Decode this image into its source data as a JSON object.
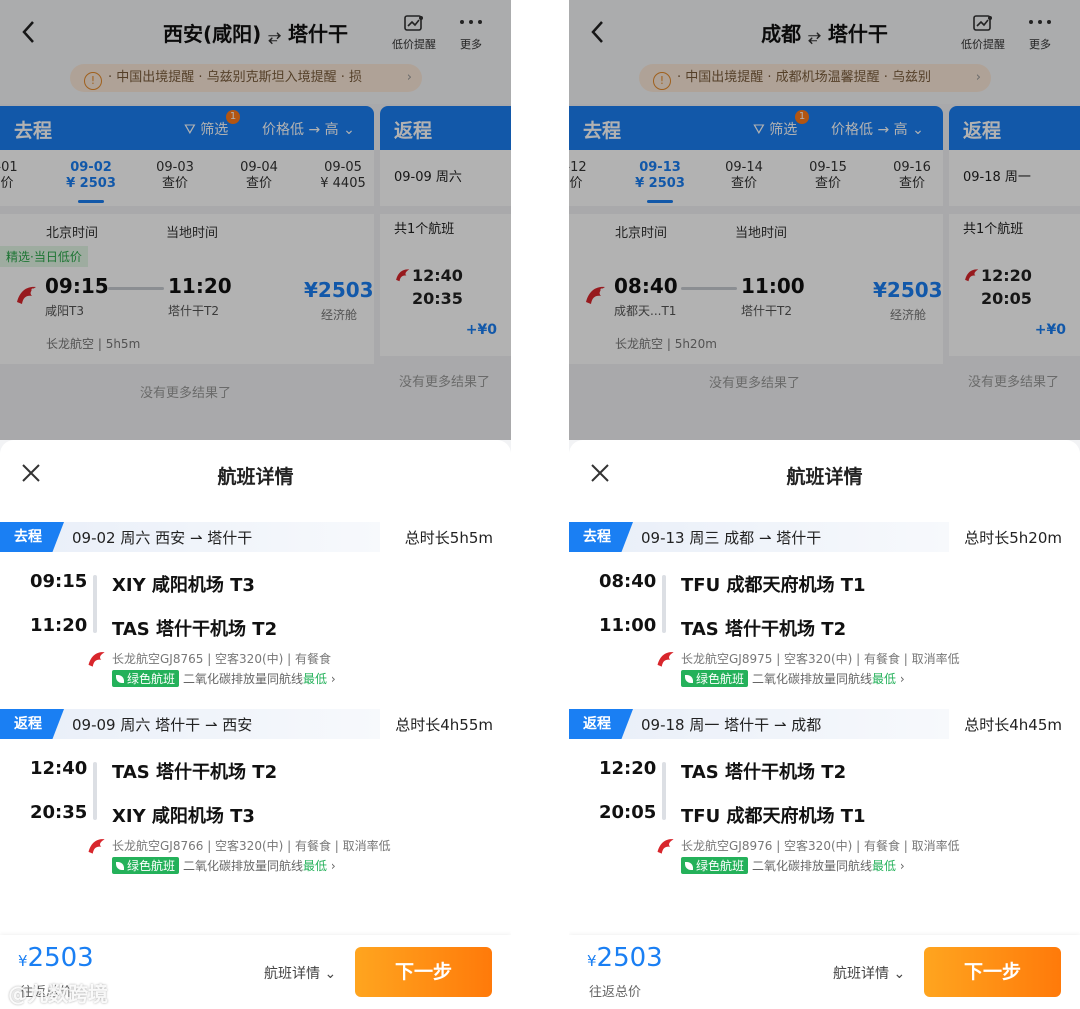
{
  "left": {
    "header": {
      "route_from": "西安(咸阳)",
      "route_to": "塔什干",
      "alert_label": "低价提醒",
      "more_label": "更多"
    },
    "notice": {
      "text": "· 中国出境提醒 · 乌兹别克斯坦入境提醒 · 损"
    },
    "outbound_tab": {
      "title": "去程",
      "filter_label": "筛选",
      "filter_badge": "1",
      "sort_label": "价格低 → 高"
    },
    "return_tab": {
      "title": "返程",
      "date": "09-09 周六",
      "count": "共1个航班",
      "dep_time": "12:40",
      "arr_time": "20:35",
      "extra_price": "+¥0",
      "no_more": "没有更多结果了"
    },
    "dates": [
      {
        "d": "-01",
        "p": "价"
      },
      {
        "d": "09-02",
        "p": "¥ 2503"
      },
      {
        "d": "09-03",
        "p": "查价"
      },
      {
        "d": "09-04",
        "p": "查价"
      },
      {
        "d": "09-05",
        "p": "¥ 4405"
      }
    ],
    "list_header": {
      "beijing": "北京时间",
      "local": "当地时间"
    },
    "flight": {
      "tag": "精选·当日低价",
      "dep": "09:15",
      "arr": "11:20",
      "dep_term": "咸阳T3",
      "arr_term": "塔什干T2",
      "price": "¥2503",
      "cabin": "经济舱",
      "airline": "长龙航空",
      "duration": "5h5m"
    },
    "no_more": "没有更多结果了",
    "sheet": {
      "title": "航班详情",
      "outbound": {
        "label": "去程",
        "info": "09-02 周六 西安 ⇀ 塔什干",
        "duration": "总时长5h5m",
        "dep_time": "09:15",
        "dep_airport": "XIY 咸阳机场 T3",
        "arr_time": "11:20",
        "arr_airport": "TAS 塔什干机场 T2",
        "flight_info": "长龙航空GJ8765 | 空客320(中) | 有餐食",
        "green_badge": "绿色航班",
        "green_text": "二氧化碳排放量同航线",
        "green_low": "最低",
        "chevron": "›"
      },
      "return": {
        "label": "返程",
        "info": "09-09 周六 塔什干 ⇀ 西安",
        "duration": "总时长4h55m",
        "dep_time": "12:40",
        "dep_airport": "TAS 塔什干机场 T2",
        "arr_time": "20:35",
        "arr_airport": "XIY 咸阳机场 T3",
        "flight_info": "长龙航空GJ8766 | 空客320(中) | 有餐食 | 取消率低",
        "green_badge": "绿色航班",
        "green_text": "二氧化碳排放量同航线",
        "green_low": "最低",
        "chevron": "›"
      }
    },
    "footer": {
      "currency": "¥",
      "price": "2503",
      "label": "往返总价",
      "detail_label": "航班详情",
      "next_label": "下一步"
    },
    "watermark": "@九数跨境"
  },
  "right": {
    "header": {
      "route_from": "成都",
      "route_to": "塔什干",
      "alert_label": "低价提醒",
      "more_label": "更多"
    },
    "notice": {
      "text": "· 中国出境提醒 · 成都机场温馨提醒 · 乌兹别"
    },
    "outbound_tab": {
      "title": "去程",
      "filter_label": "筛选",
      "filter_badge": "1",
      "sort_label": "价格低 → 高"
    },
    "return_tab": {
      "title": "返程",
      "date": "09-18 周一",
      "count": "共1个航班",
      "dep_time": "12:20",
      "arr_time": "20:05",
      "extra_price": "+¥0",
      "no_more": "没有更多结果了"
    },
    "dates": [
      {
        "d": "-12",
        "p": "价"
      },
      {
        "d": "09-13",
        "p": "¥ 2503"
      },
      {
        "d": "09-14",
        "p": "查价"
      },
      {
        "d": "09-15",
        "p": "查价"
      },
      {
        "d": "09-16",
        "p": "查价"
      }
    ],
    "list_header": {
      "beijing": "北京时间",
      "local": "当地时间"
    },
    "flight": {
      "tag": "",
      "dep": "08:40",
      "arr": "11:00",
      "dep_term": "成都天...T1",
      "arr_term": "塔什干T2",
      "price": "¥2503",
      "cabin": "经济舱",
      "airline": "长龙航空",
      "duration": "5h20m"
    },
    "no_more": "没有更多结果了",
    "sheet": {
      "title": "航班详情",
      "outbound": {
        "label": "去程",
        "info": "09-13 周三 成都 ⇀ 塔什干",
        "duration": "总时长5h20m",
        "dep_time": "08:40",
        "dep_airport": "TFU 成都天府机场 T1",
        "arr_time": "11:00",
        "arr_airport": "TAS 塔什干机场 T2",
        "flight_info": "长龙航空GJ8975 | 空客320(中) | 有餐食 | 取消率低",
        "green_badge": "绿色航班",
        "green_text": "二氧化碳排放量同航线",
        "green_low": "最低",
        "chevron": "›"
      },
      "return": {
        "label": "返程",
        "info": "09-18 周一 塔什干 ⇀ 成都",
        "duration": "总时长4h45m",
        "dep_time": "12:20",
        "dep_airport": "TAS 塔什干机场 T2",
        "arr_time": "20:05",
        "arr_airport": "TFU 成都天府机场 T1",
        "flight_info": "长龙航空GJ8976 | 空客320(中) | 有餐食 | 取消率低",
        "green_badge": "绿色航班",
        "green_text": "二氧化碳排放量同航线",
        "green_low": "最低",
        "chevron": "›"
      }
    },
    "footer": {
      "currency": "¥",
      "price": "2503",
      "label": "往返总价",
      "detail_label": "航班详情",
      "next_label": "下一步"
    }
  },
  "colors": {
    "accent": "#1a7ff3",
    "orange": "#ff7a0a",
    "green": "#24b15a"
  }
}
